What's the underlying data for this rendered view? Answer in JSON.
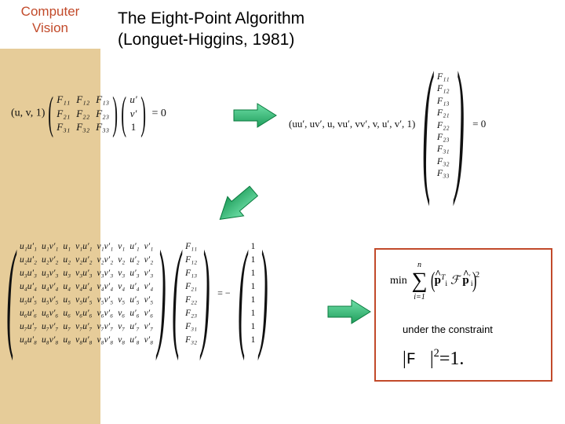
{
  "brand": {
    "line1": "Computer",
    "line2": "Vision"
  },
  "title": {
    "line1": "The Eight-Point Algorithm",
    "line2": "(Longuet-Higgins, 1981)"
  },
  "eq1": {
    "rowvec": "(u, v, 1)",
    "F": {
      "c1": [
        "F₁₁",
        "F₂₁",
        "F₃₁"
      ],
      "c2": [
        "F₁₂",
        "F₂₂",
        "F₃₂"
      ],
      "c3": [
        "F₁₃",
        "F₂₃",
        "F₃₃"
      ]
    },
    "vec": [
      "u′",
      "v′",
      "1"
    ],
    "rhs": "= 0"
  },
  "eq2": {
    "rowvec": "(uu′, uv′, u, vu′, vv′, v, u′, v′, 1)",
    "vec": [
      "F₁₁",
      "F₁₂",
      "F₁₃",
      "F₂₁",
      "F₂₂",
      "F₂₃",
      "F₃₁",
      "F₃₂",
      "F₃₃"
    ],
    "rhs": "= 0"
  },
  "eq3": {
    "cols": [
      [
        "u₁u′₁",
        "u₂u′₂",
        "u₃u′₃",
        "u₄u′₄",
        "u₅u′₅",
        "u₆u′₆",
        "u₇u′₇",
        "u₈u′₈"
      ],
      [
        "u₁v′₁",
        "u₂v′₂",
        "u₃v′₃",
        "u₄v′₄",
        "u₅v′₅",
        "u₆v′₆",
        "u₇v′₇",
        "u₈v′₈"
      ],
      [
        "u₁",
        "u₂",
        "u₃",
        "u₄",
        "u₅",
        "u₆",
        "u₇",
        "u₈"
      ],
      [
        "v₁u′₁",
        "v₂u′₂",
        "v₃u′₃",
        "v₄u′₄",
        "v₅u′₅",
        "v₆u′₆",
        "v₇u′₇",
        "v₈u′₈"
      ],
      [
        "v₁v′₁",
        "v₂v′₂",
        "v₃v′₃",
        "v₄v′₄",
        "v₅v′₅",
        "v₆v′₆",
        "v₇v′₇",
        "v₈v′₈"
      ],
      [
        "v₁",
        "v₂",
        "v₃",
        "v₄",
        "v₅",
        "v₆",
        "v₇",
        "v₈"
      ],
      [
        "u′₁",
        "u′₂",
        "u′₃",
        "u′₄",
        "u′₅",
        "u′₆",
        "u′₇",
        "u′₈"
      ],
      [
        "v′₁",
        "v′₂",
        "v′₃",
        "v′₄",
        "v′₅",
        "v′₆",
        "v′₇",
        "v′₈"
      ]
    ],
    "fvec": [
      "F₁₁",
      "F₁₂",
      "F₁₃",
      "F₂₁",
      "F₂₂",
      "F₂₃",
      "F₃₁",
      "F₃₂"
    ],
    "eq": "= −",
    "ones": [
      "1",
      "1",
      "1",
      "1",
      "1",
      "1",
      "1",
      "1"
    ]
  },
  "constraint": {
    "sum_top": "n",
    "sum_bot": "i=1",
    "label": "under the constraint",
    "norm_eq_left": "|",
    "norm_eq_F": "F",
    "norm_eq_mid": "|",
    "norm_eq_sq": "2",
    "norm_eq_rhs": "=1."
  }
}
